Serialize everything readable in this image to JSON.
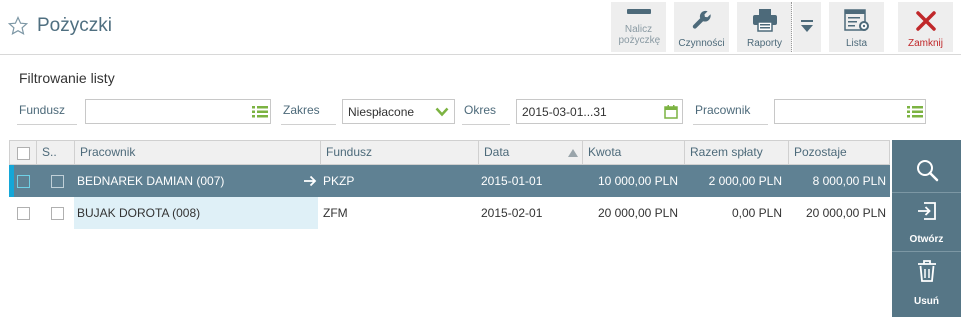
{
  "header": {
    "title": "Pożyczki",
    "buttons": {
      "nalicz": "Nalicz pożyczkę",
      "czynnosci": "Czynności",
      "raporty": "Raporty",
      "lista": "Lista",
      "zamknij": "Zamknij"
    }
  },
  "filter": {
    "title": "Filtrowanie listy",
    "fundusz_label": "Fundusz",
    "fundusz_value": "",
    "zakres_label": "Zakres",
    "zakres_value": "Niespłacone",
    "okres_label": "Okres",
    "okres_value": "2015-03-01...31",
    "pracownik_label": "Pracownik",
    "pracownik_value": ""
  },
  "table": {
    "columns": [
      "S..",
      "Pracownik",
      "Fundusz",
      "Data",
      "Kwota",
      "Razem spłaty",
      "Pozostaje"
    ],
    "rows": [
      {
        "pracownik": "BEDNAREK DAMIAN (007)",
        "fundusz": "PKZP",
        "data": "2015-01-01",
        "kwota": "10 000,00 PLN",
        "razem": "2 000,00 PLN",
        "pozostaje": "8 000,00 PLN"
      },
      {
        "pracownik": "BUJAK DOROTA (008)",
        "fundusz": "ZFM",
        "data": "2015-02-01",
        "kwota": "20 000,00 PLN",
        "razem": "0,00 PLN",
        "pozostaje": "20 000,00 PLN"
      }
    ]
  },
  "side": {
    "otworz": "Otwórz",
    "usun": "Usuń"
  },
  "colors": {
    "accent": "#5f8193",
    "side_panel": "#567686",
    "close_red": "#c0282a",
    "select_indicator": "#14a7d8"
  }
}
